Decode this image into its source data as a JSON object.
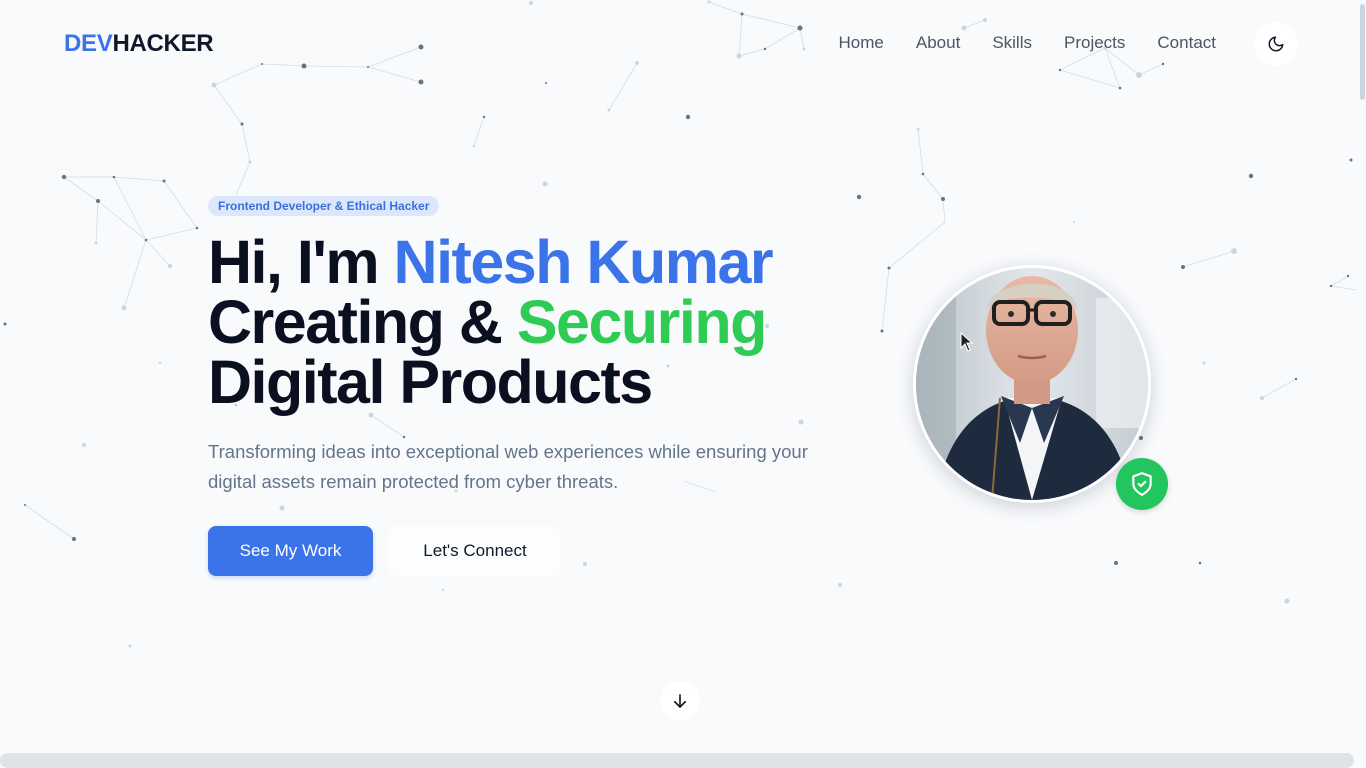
{
  "header": {
    "logo_part1": "DEV",
    "logo_part2": "HACKER",
    "nav": [
      "Home",
      "About",
      "Skills",
      "Projects",
      "Contact"
    ],
    "theme_toggle_icon": "moon-icon"
  },
  "hero": {
    "badge": "Frontend Developer & Ethical Hacker",
    "line1_prefix": "Hi, I'm ",
    "line1_name": "Nitesh Kumar",
    "line2_prefix": "Creating & ",
    "line2_highlight": "Securing",
    "line3": "Digital Products",
    "subtitle": "Transforming ideas into exceptional web experiences while ensuring your digital assets remain protected from cyber threats.",
    "primary_button": "See My Work",
    "secondary_button": "Let's Connect"
  },
  "avatar": {
    "shield_icon": "shield-check-icon"
  },
  "colors": {
    "accent_blue": "#3b73e8",
    "accent_green": "#2ecc55",
    "background": "#f8fafc"
  },
  "scroll_icon": "arrow-down-icon"
}
